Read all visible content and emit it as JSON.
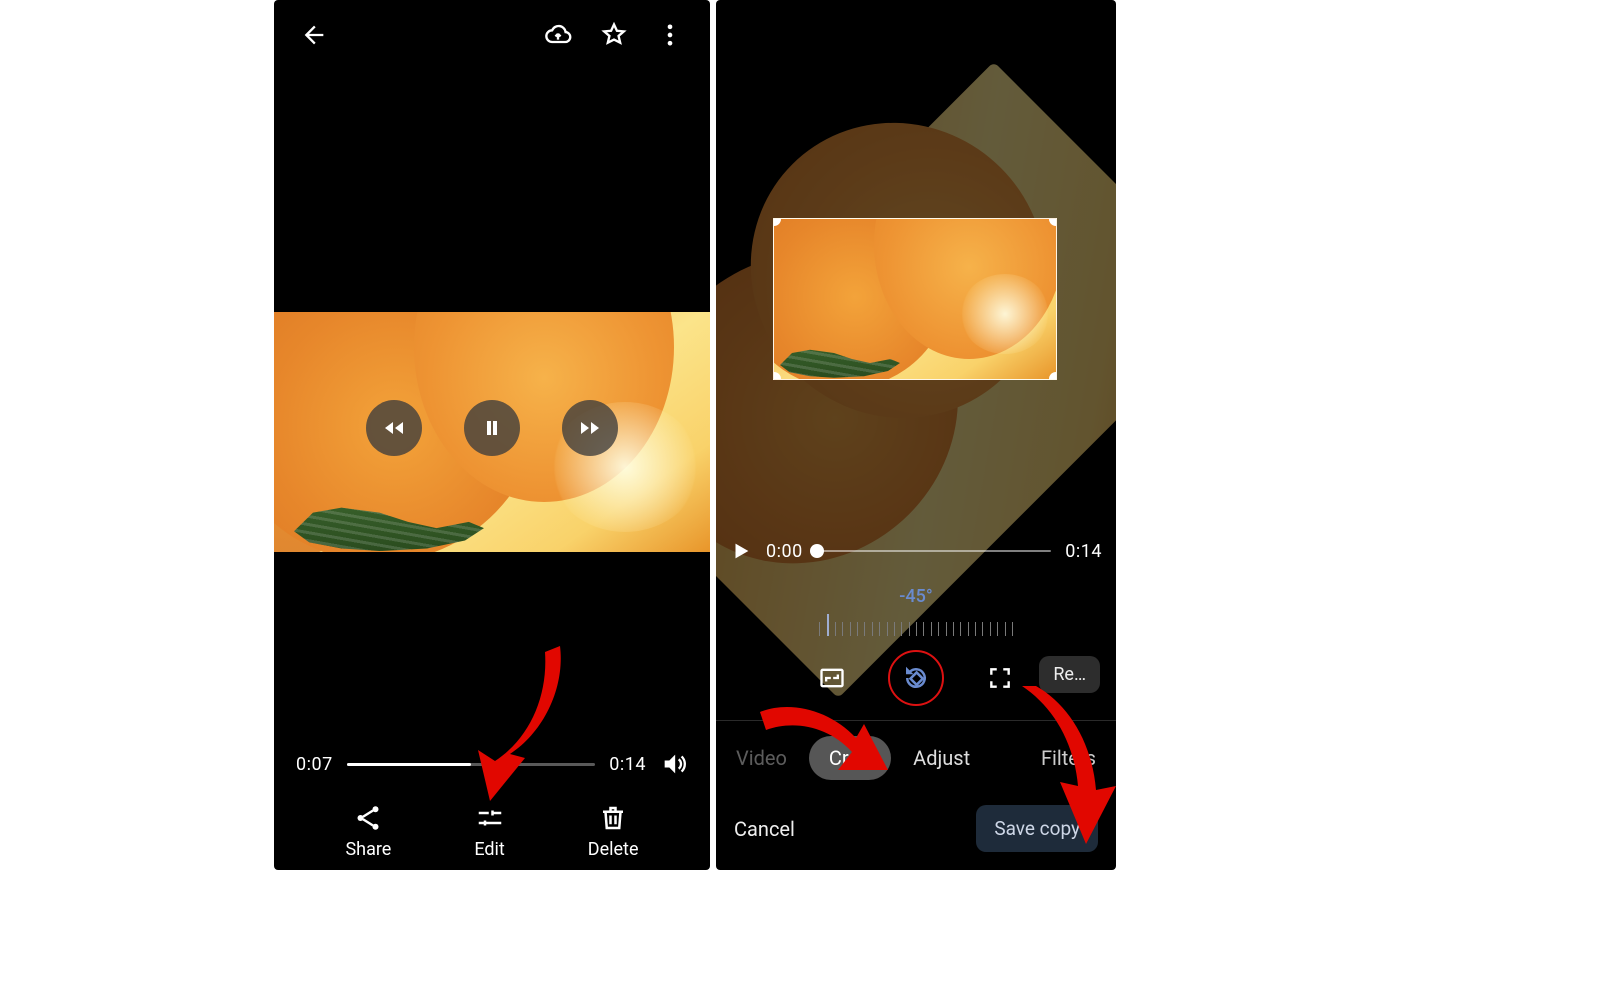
{
  "left": {
    "playback": {
      "current": "0:07",
      "duration": "0:14"
    },
    "actions": {
      "share": "Share",
      "edit": "Edit",
      "delete": "Delete"
    }
  },
  "right": {
    "playback": {
      "current": "0:00",
      "duration": "0:14"
    },
    "angle_label": "-45°",
    "reset_label": "Re…",
    "tabs": {
      "video": "Video",
      "crop": "Crop",
      "adjust": "Adjust",
      "filters": "Filters"
    },
    "footer": {
      "cancel": "Cancel",
      "save": "Save copy"
    }
  }
}
